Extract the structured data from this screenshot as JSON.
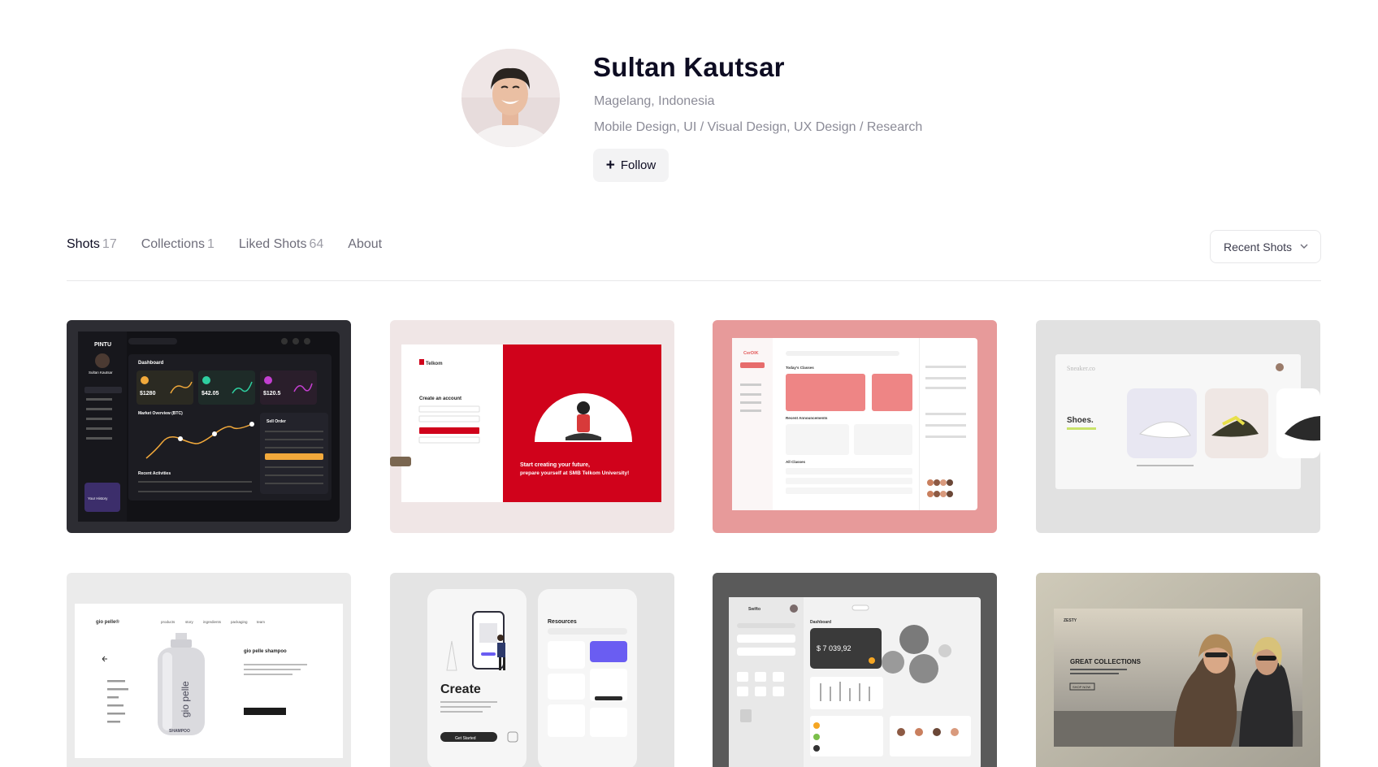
{
  "profile": {
    "name": "Sultan Kautsar",
    "location": "Magelang, Indonesia",
    "skills": "Mobile Design, UI / Visual Design, UX Design / Research",
    "follow_label": "Follow"
  },
  "tabs": [
    {
      "label": "Shots",
      "count": "17"
    },
    {
      "label": "Collections",
      "count": "1"
    },
    {
      "label": "Liked Shots",
      "count": "64"
    },
    {
      "label": "About",
      "count": ""
    }
  ],
  "sort": {
    "label": "Recent Shots"
  },
  "shots": {
    "s1": {
      "brand": "PINTU",
      "title": "Dashboard",
      "user": "Sultan Kautsar",
      "v1": "$1280",
      "v2": "$42.05",
      "v3": "$120.5",
      "chart": "Market Overview (BTC)",
      "orders": "Sell Order",
      "activities": "Recent Activities",
      "history": "Your History"
    },
    "s2": {
      "brand": "Telkom",
      "heading": "Create an account",
      "tagline1": "Start creating your future,",
      "tagline2": "prepare yourself at SMB Telkom University!"
    },
    "s3": {
      "brand": "CerDIK",
      "classes": "Today's Classes",
      "announce": "Recent Announcements",
      "all": "All Classes"
    },
    "s4": {
      "brand": "Sneaker.co",
      "title": "Shoes."
    },
    "s5": {
      "brand": "gio pelle®",
      "product": "gio pelle shampoo",
      "bottle_line1": "gio pelle",
      "bottle_line2": "SHAMPOO",
      "nav": [
        "products",
        "story",
        "ingredients",
        "packaging",
        "team"
      ]
    },
    "s6": {
      "title": "Create",
      "section": "Resources",
      "cta": "Get Started"
    },
    "s7": {
      "brand": "Swifto",
      "section": "Dashboard",
      "balance": "$ 7 039,92"
    },
    "s8": {
      "brand": "ZESTY",
      "title": "GREAT COLLECTIONS",
      "cta": "SHOP NOW"
    }
  }
}
